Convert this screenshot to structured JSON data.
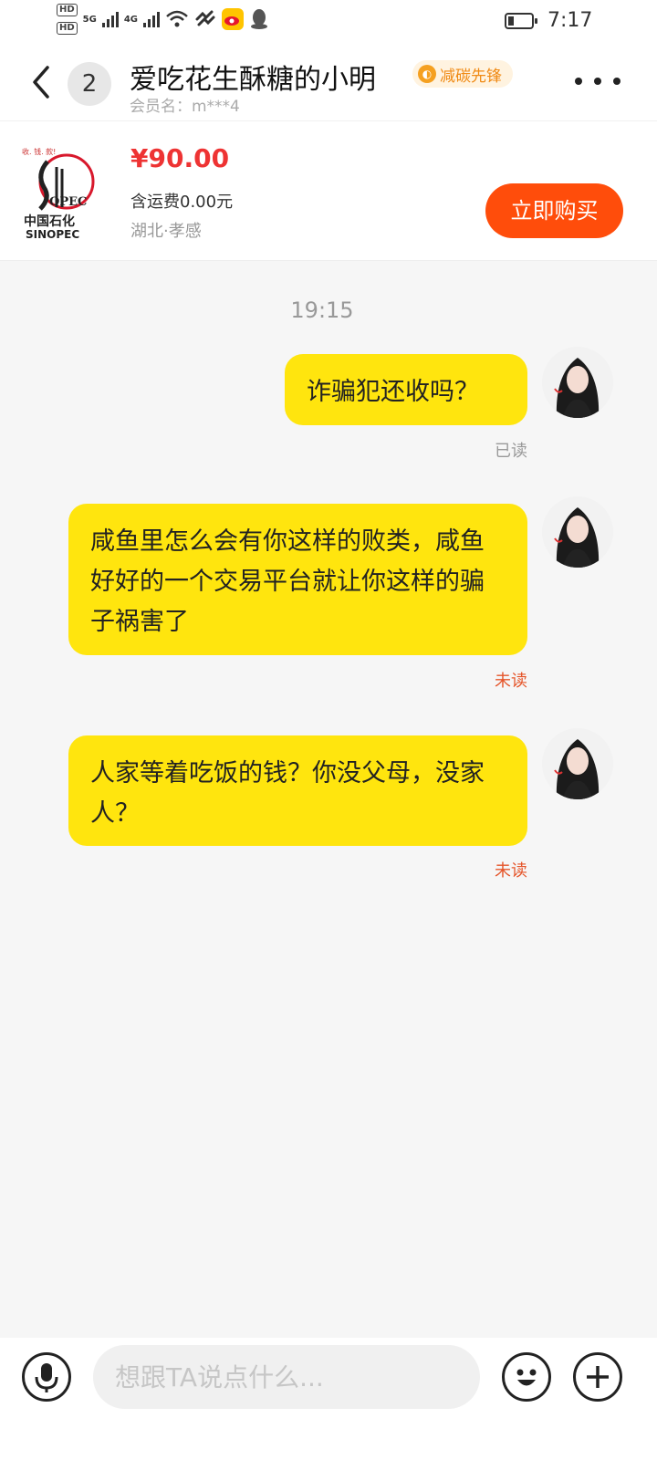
{
  "status_bar": {
    "sim1_label": "HD",
    "sim2_label": "HD",
    "network1": "5G",
    "network2": "4G",
    "time": "7:17",
    "icons": [
      "signal-icon",
      "wifi-icon",
      "heart-rate-icon",
      "weibo-icon",
      "qq-icon",
      "battery-icon"
    ]
  },
  "header": {
    "back_icon": "chevron-left-icon",
    "unread_count": "2",
    "title": "爱吃花生酥糖的小明",
    "badge_label": "减碳先锋",
    "subtitle": "会员名：m***4",
    "more_icon": "more-dots-icon"
  },
  "product": {
    "brand_top": "中国石化",
    "brand_bottom": "SINOPEC",
    "price": "¥90.00",
    "shipping": "含运费0.00元",
    "location": "湖北·孝感",
    "buy_label": "立即购买",
    "accent_color": "#ff4d0b",
    "price_color": "#ee3333"
  },
  "chat": {
    "timestamp": "19:15",
    "messages": [
      {
        "text": "诈骗犯还收吗？",
        "status": "已读"
      },
      {
        "text": "咸鱼里怎么会有你这样的败类，咸鱼好好的一个交易平台就让你这样的骗子祸害了",
        "status": "未读"
      },
      {
        "text": "人家等着吃饭的钱？你没父母，没家人？",
        "status": "未读"
      }
    ],
    "bubble_color": "#ffe50e"
  },
  "input_bar": {
    "placeholder": "想跟TA说点什么...",
    "mic_icon": "microphone-icon",
    "emoji_icon": "smile-icon",
    "plus_icon": "plus-icon"
  }
}
